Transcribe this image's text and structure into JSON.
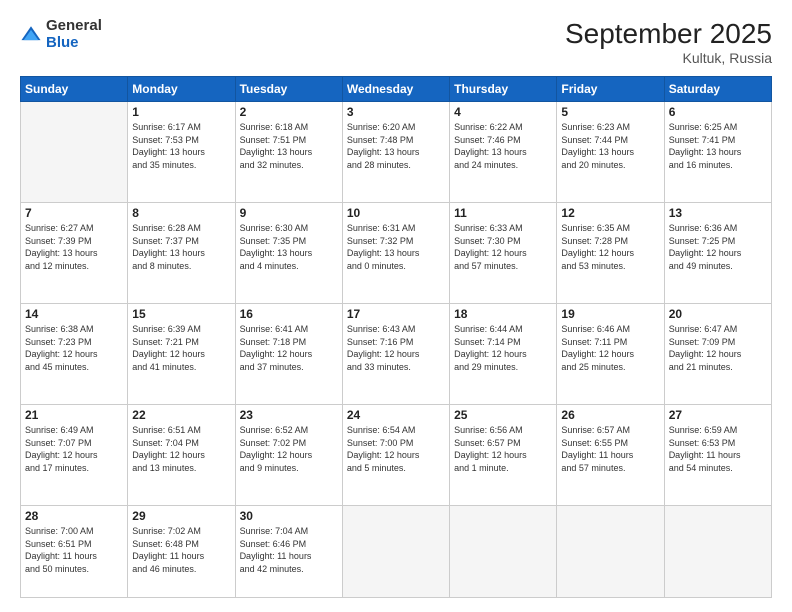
{
  "logo": {
    "general": "General",
    "blue": "Blue"
  },
  "title": "September 2025",
  "location": "Kultuk, Russia",
  "days_header": [
    "Sunday",
    "Monday",
    "Tuesday",
    "Wednesday",
    "Thursday",
    "Friday",
    "Saturday"
  ],
  "weeks": [
    [
      {
        "day": "",
        "info": ""
      },
      {
        "day": "1",
        "info": "Sunrise: 6:17 AM\nSunset: 7:53 PM\nDaylight: 13 hours\nand 35 minutes."
      },
      {
        "day": "2",
        "info": "Sunrise: 6:18 AM\nSunset: 7:51 PM\nDaylight: 13 hours\nand 32 minutes."
      },
      {
        "day": "3",
        "info": "Sunrise: 6:20 AM\nSunset: 7:48 PM\nDaylight: 13 hours\nand 28 minutes."
      },
      {
        "day": "4",
        "info": "Sunrise: 6:22 AM\nSunset: 7:46 PM\nDaylight: 13 hours\nand 24 minutes."
      },
      {
        "day": "5",
        "info": "Sunrise: 6:23 AM\nSunset: 7:44 PM\nDaylight: 13 hours\nand 20 minutes."
      },
      {
        "day": "6",
        "info": "Sunrise: 6:25 AM\nSunset: 7:41 PM\nDaylight: 13 hours\nand 16 minutes."
      }
    ],
    [
      {
        "day": "7",
        "info": "Sunrise: 6:27 AM\nSunset: 7:39 PM\nDaylight: 13 hours\nand 12 minutes."
      },
      {
        "day": "8",
        "info": "Sunrise: 6:28 AM\nSunset: 7:37 PM\nDaylight: 13 hours\nand 8 minutes."
      },
      {
        "day": "9",
        "info": "Sunrise: 6:30 AM\nSunset: 7:35 PM\nDaylight: 13 hours\nand 4 minutes."
      },
      {
        "day": "10",
        "info": "Sunrise: 6:31 AM\nSunset: 7:32 PM\nDaylight: 13 hours\nand 0 minutes."
      },
      {
        "day": "11",
        "info": "Sunrise: 6:33 AM\nSunset: 7:30 PM\nDaylight: 12 hours\nand 57 minutes."
      },
      {
        "day": "12",
        "info": "Sunrise: 6:35 AM\nSunset: 7:28 PM\nDaylight: 12 hours\nand 53 minutes."
      },
      {
        "day": "13",
        "info": "Sunrise: 6:36 AM\nSunset: 7:25 PM\nDaylight: 12 hours\nand 49 minutes."
      }
    ],
    [
      {
        "day": "14",
        "info": "Sunrise: 6:38 AM\nSunset: 7:23 PM\nDaylight: 12 hours\nand 45 minutes."
      },
      {
        "day": "15",
        "info": "Sunrise: 6:39 AM\nSunset: 7:21 PM\nDaylight: 12 hours\nand 41 minutes."
      },
      {
        "day": "16",
        "info": "Sunrise: 6:41 AM\nSunset: 7:18 PM\nDaylight: 12 hours\nand 37 minutes."
      },
      {
        "day": "17",
        "info": "Sunrise: 6:43 AM\nSunset: 7:16 PM\nDaylight: 12 hours\nand 33 minutes."
      },
      {
        "day": "18",
        "info": "Sunrise: 6:44 AM\nSunset: 7:14 PM\nDaylight: 12 hours\nand 29 minutes."
      },
      {
        "day": "19",
        "info": "Sunrise: 6:46 AM\nSunset: 7:11 PM\nDaylight: 12 hours\nand 25 minutes."
      },
      {
        "day": "20",
        "info": "Sunrise: 6:47 AM\nSunset: 7:09 PM\nDaylight: 12 hours\nand 21 minutes."
      }
    ],
    [
      {
        "day": "21",
        "info": "Sunrise: 6:49 AM\nSunset: 7:07 PM\nDaylight: 12 hours\nand 17 minutes."
      },
      {
        "day": "22",
        "info": "Sunrise: 6:51 AM\nSunset: 7:04 PM\nDaylight: 12 hours\nand 13 minutes."
      },
      {
        "day": "23",
        "info": "Sunrise: 6:52 AM\nSunset: 7:02 PM\nDaylight: 12 hours\nand 9 minutes."
      },
      {
        "day": "24",
        "info": "Sunrise: 6:54 AM\nSunset: 7:00 PM\nDaylight: 12 hours\nand 5 minutes."
      },
      {
        "day": "25",
        "info": "Sunrise: 6:56 AM\nSunset: 6:57 PM\nDaylight: 12 hours\nand 1 minute."
      },
      {
        "day": "26",
        "info": "Sunrise: 6:57 AM\nSunset: 6:55 PM\nDaylight: 11 hours\nand 57 minutes."
      },
      {
        "day": "27",
        "info": "Sunrise: 6:59 AM\nSunset: 6:53 PM\nDaylight: 11 hours\nand 54 minutes."
      }
    ],
    [
      {
        "day": "28",
        "info": "Sunrise: 7:00 AM\nSunset: 6:51 PM\nDaylight: 11 hours\nand 50 minutes."
      },
      {
        "day": "29",
        "info": "Sunrise: 7:02 AM\nSunset: 6:48 PM\nDaylight: 11 hours\nand 46 minutes."
      },
      {
        "day": "30",
        "info": "Sunrise: 7:04 AM\nSunset: 6:46 PM\nDaylight: 11 hours\nand 42 minutes."
      },
      {
        "day": "",
        "info": ""
      },
      {
        "day": "",
        "info": ""
      },
      {
        "day": "",
        "info": ""
      },
      {
        "day": "",
        "info": ""
      }
    ]
  ]
}
